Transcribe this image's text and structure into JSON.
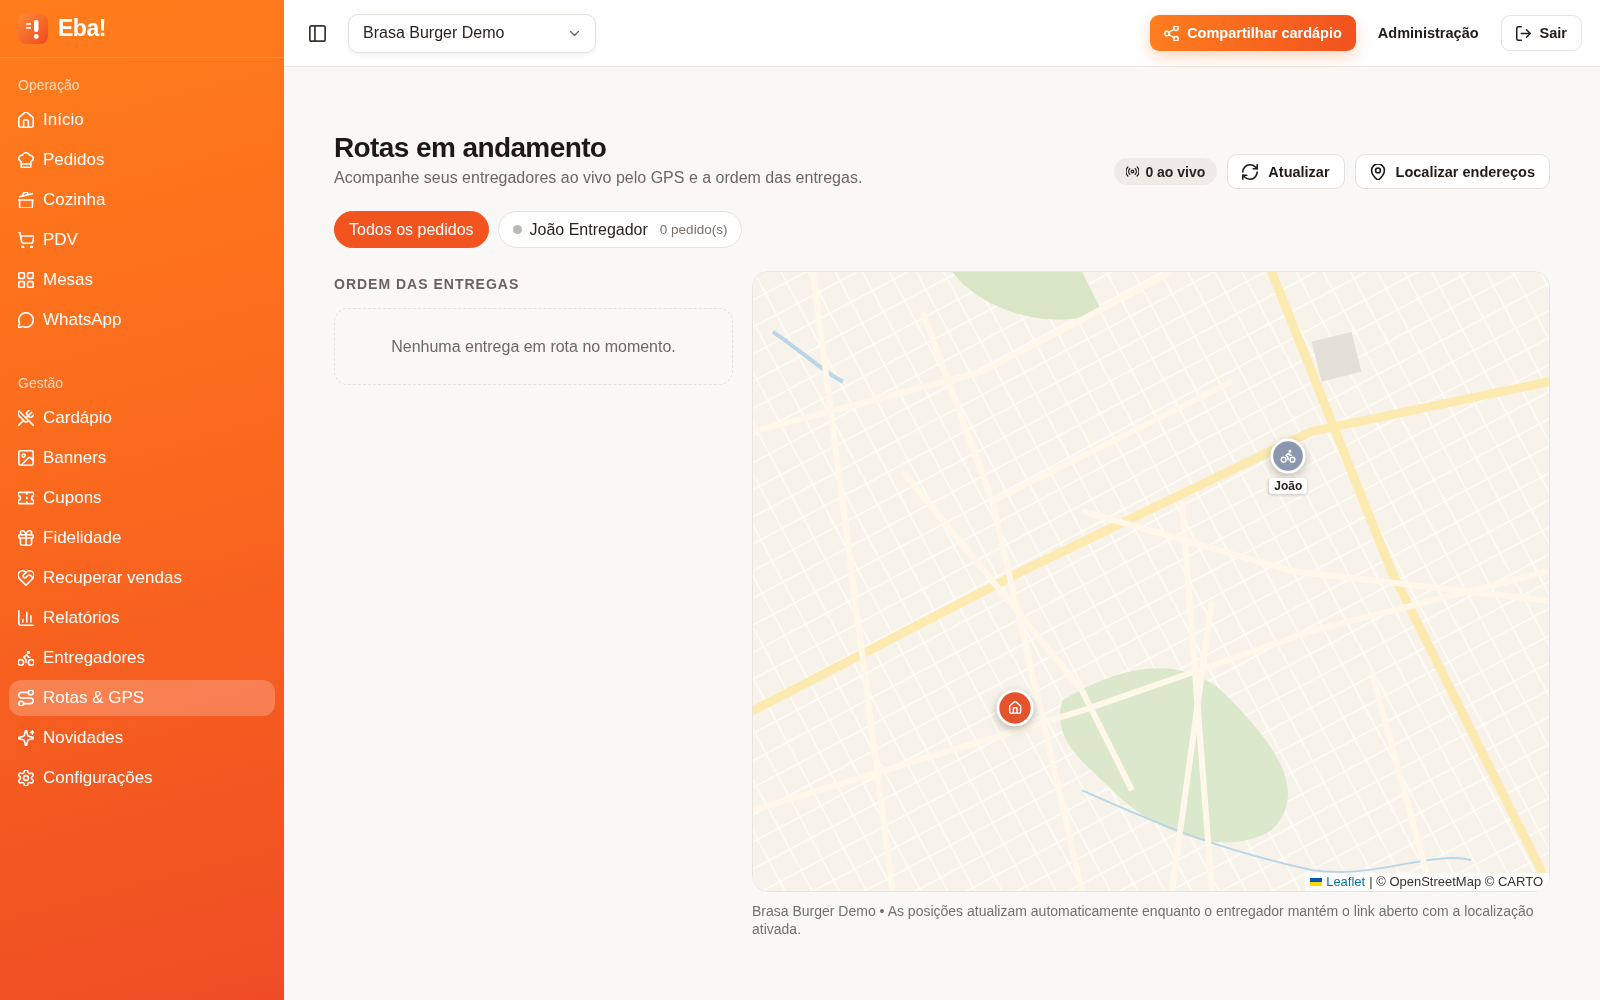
{
  "brand": {
    "name": "Eba!"
  },
  "sidebar": {
    "sections": [
      {
        "title": "Operação",
        "items": [
          {
            "label": "Início",
            "selected": false
          },
          {
            "label": "Pedidos",
            "selected": false
          },
          {
            "label": "Cozinha",
            "selected": false
          },
          {
            "label": "PDV",
            "selected": false
          },
          {
            "label": "Mesas",
            "selected": false
          },
          {
            "label": "WhatsApp",
            "selected": false
          }
        ]
      },
      {
        "title": "Gestão",
        "items": [
          {
            "label": "Cardápio",
            "selected": false
          },
          {
            "label": "Banners",
            "selected": false
          },
          {
            "label": "Cupons",
            "selected": false
          },
          {
            "label": "Fidelidade",
            "selected": false
          },
          {
            "label": "Recuperar vendas",
            "selected": false
          },
          {
            "label": "Relatórios",
            "selected": false
          },
          {
            "label": "Entregadores",
            "selected": false
          },
          {
            "label": "Rotas & GPS",
            "selected": true
          },
          {
            "label": "Novidades",
            "selected": false
          },
          {
            "label": "Configurações",
            "selected": false
          }
        ]
      }
    ]
  },
  "topbar": {
    "store_select": {
      "value": "Brasa Burger Demo"
    },
    "share_button": "Compartilhar cardápio",
    "admin_link": "Administração",
    "logout_button": "Sair"
  },
  "header": {
    "title": "Rotas em andamento",
    "subtitle": "Acompanhe seus entregadores ao vivo pelo GPS e a ordem das entregas.",
    "live_badge": "0 ao vivo",
    "refresh_button": "Atualizar",
    "locate_button": "Localizar endereços"
  },
  "filters": [
    {
      "label": "Todos os pedidos",
      "selected": true
    },
    {
      "label": "João Entregador",
      "count": "0 pedido(s)",
      "online": false,
      "selected": false
    }
  ],
  "deliveries": {
    "heading": "ORDEM DAS ENTREGAS",
    "empty_message": "Nenhuma entrega em rota no momento."
  },
  "map": {
    "markers": [
      {
        "kind": "courier",
        "label": "João"
      },
      {
        "kind": "store"
      }
    ],
    "attribution": {
      "link": "Leaflet",
      "text": "| © OpenStreetMap © CARTO"
    }
  },
  "footnote": "Brasa Burger Demo • As posições atualizam automaticamente enquanto o entregador mantém o link aberto com a localização ativada."
}
